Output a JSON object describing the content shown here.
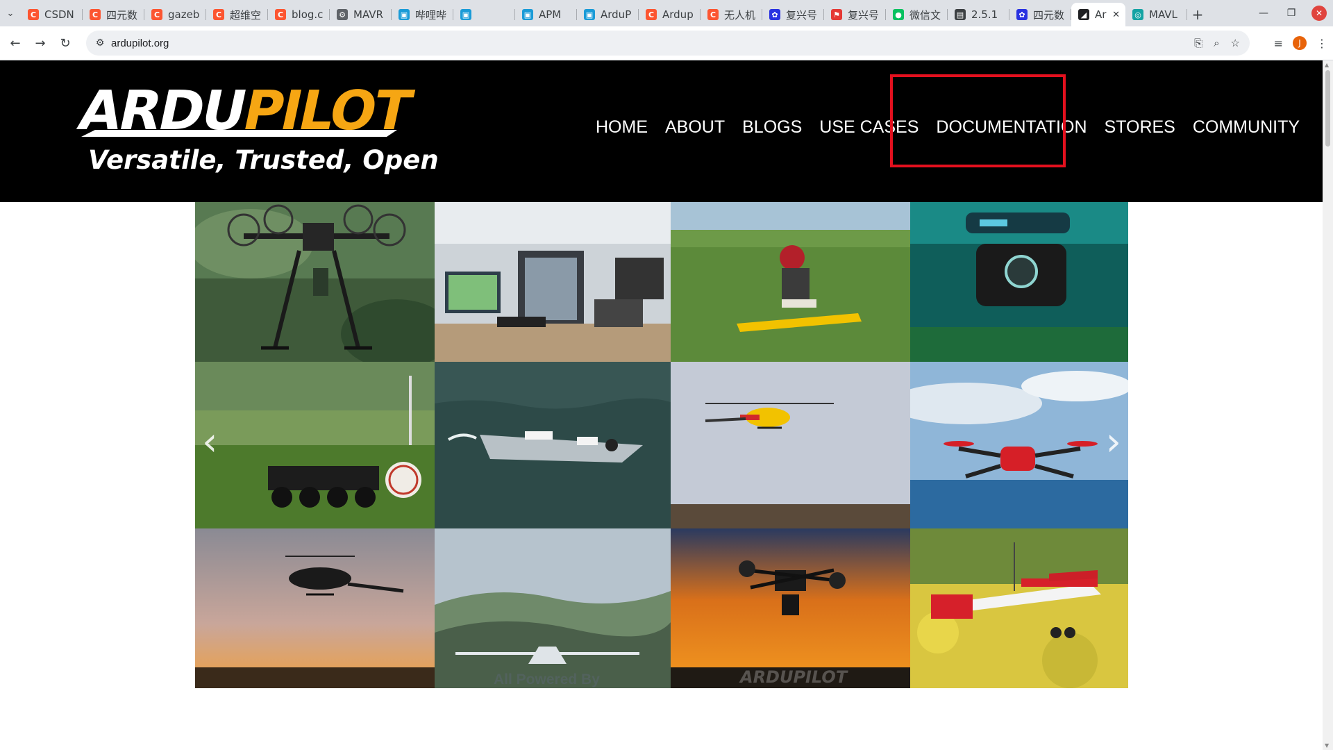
{
  "browser": {
    "tabs": [
      {
        "title": "CSDN",
        "icon": "csdn-icon",
        "color": "#fc5531"
      },
      {
        "title": "四元数",
        "icon": "csdn-icon",
        "color": "#fc5531"
      },
      {
        "title": "gazeb",
        "icon": "csdn-icon",
        "color": "#fc5531"
      },
      {
        "title": "超维空",
        "icon": "csdn-icon",
        "color": "#fc5531"
      },
      {
        "title": "blog.c",
        "icon": "csdn-icon",
        "color": "#fc5531"
      },
      {
        "title": "MAVR",
        "icon": "gear-icon",
        "color": "#5f6368"
      },
      {
        "title": "哔哩哔",
        "icon": "bilibili-icon",
        "color": "#1a9bd7"
      },
      {
        "title": "",
        "icon": "bilibili-icon",
        "color": "#1a9bd7"
      },
      {
        "title": "APM",
        "icon": "bilibili-icon",
        "color": "#1a9bd7"
      },
      {
        "title": "ArduP",
        "icon": "bilibili-icon",
        "color": "#1a9bd7"
      },
      {
        "title": "Ardup",
        "icon": "csdn-icon",
        "color": "#fc5531"
      },
      {
        "title": "无人机",
        "icon": "csdn-icon",
        "color": "#fc5531"
      },
      {
        "title": "复兴号",
        "icon": "baidu-icon",
        "color": "#2932e1"
      },
      {
        "title": "复兴号",
        "icon": "pin-icon",
        "color": "#e53935"
      },
      {
        "title": "微信文",
        "icon": "wechat-icon",
        "color": "#07c160"
      },
      {
        "title": "2.5.1",
        "icon": "book-icon",
        "color": "#3c4043"
      },
      {
        "title": "四元数",
        "icon": "baidu-icon",
        "color": "#2932e1"
      },
      {
        "title": "Ar",
        "icon": "ardupilot-icon",
        "color": "#202124"
      },
      {
        "title": "MAVL",
        "icon": "mavlink-icon",
        "color": "#14a3a3"
      }
    ],
    "active_tab_index": 17,
    "url": "ardupilot.org",
    "profile_initial": "J"
  },
  "site": {
    "logo": {
      "word_white": "ARDU",
      "word_orange": "PILOT",
      "tagline": "Versatile, Trusted, Open",
      "colors": {
        "white": "#ffffff",
        "orange": "#f6a613"
      }
    },
    "nav": {
      "home": "HOME",
      "about": "ABOUT",
      "blogs": "BLOGS",
      "use_cases": "USE CASES",
      "documentation": "DOCUMENTATION",
      "stores": "STORES",
      "community": "COMMUNITY"
    },
    "highlight_color": "#e3101e"
  },
  "carousel": {
    "tiles": [
      {
        "subject": "hexacopter-drone"
      },
      {
        "subject": "ground-control-station"
      },
      {
        "subject": "fixed-wing-pilot-field"
      },
      {
        "subject": "underwater-rov"
      },
      {
        "subject": "ground-rover"
      },
      {
        "subject": "surface-boat"
      },
      {
        "subject": "helicopter-sky"
      },
      {
        "subject": "quadcopter-over-sea"
      },
      {
        "subject": "helicopter-sunset"
      },
      {
        "subject": "glider-over-valley",
        "caption": "All Powered By"
      },
      {
        "subject": "octocopter-sunset",
        "caption": "ARDUPILOT"
      },
      {
        "subject": "red-plane-flowers"
      }
    ],
    "prev_icon": "chevron-left-icon",
    "next_icon": "chevron-right-icon"
  }
}
